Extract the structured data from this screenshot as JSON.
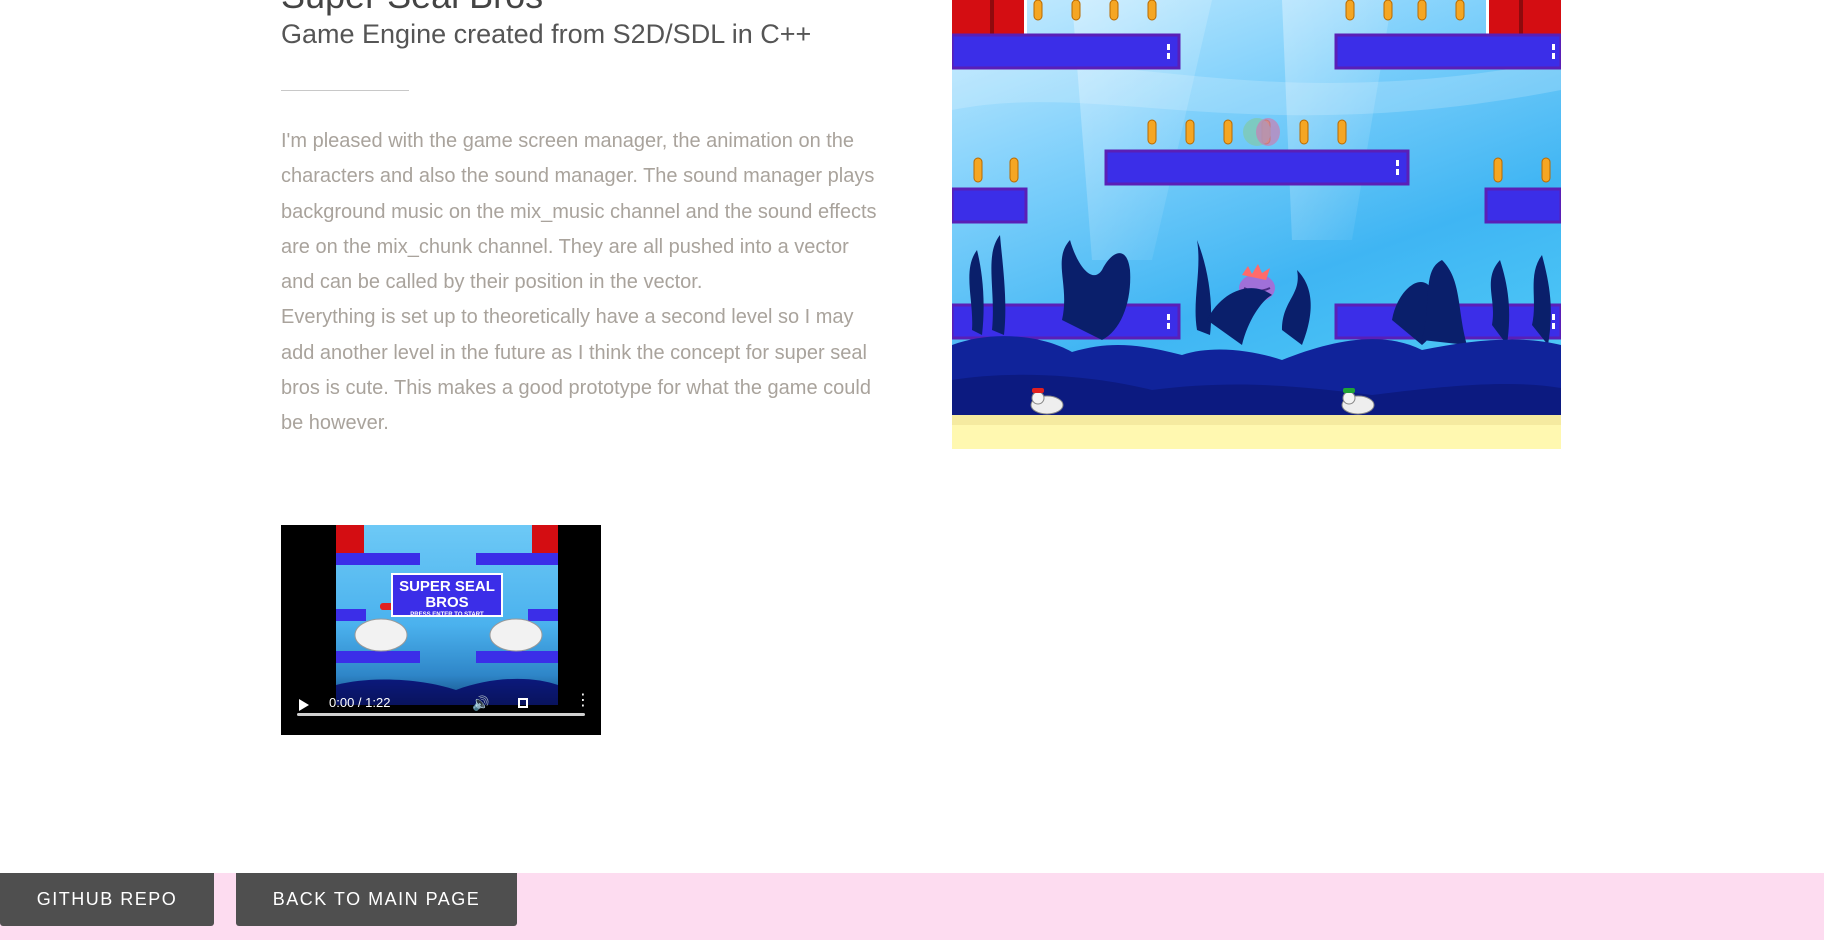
{
  "project": {
    "title": "Super Seal Bros",
    "subtitle": "Game Engine created from S2D/SDL in C++",
    "description": [
      "I'm pleased with the game screen manager, the animation on the characters and also the sound manager. The sound manager plays background music on the mix_music channel and the sound effects are on the mix_chunk channel. They are all pushed into a vector and can be called by their position in the vector.",
      "Everything is set up to theoretically have a second level so I may add another level in the future as I think the concept for super seal bros is cute. This makes a good prototype for what the game could be however."
    ]
  },
  "video": {
    "title_line1": "SUPER SEAL",
    "title_line2": "BROS",
    "title_prompt": "PRESS ENTER TO START",
    "time": "0:00 / 1:22",
    "progress": 0
  },
  "footer": {
    "github_label": "GITHUB REPO",
    "back_label": "BACK TO MAIN PAGE"
  },
  "colors": {
    "footer_bg": "#fddcf0",
    "button_bg": "#4f4f4f",
    "platform": "#3b2ee8",
    "pipe": "#d40d12",
    "sand": "#fff8b0"
  }
}
